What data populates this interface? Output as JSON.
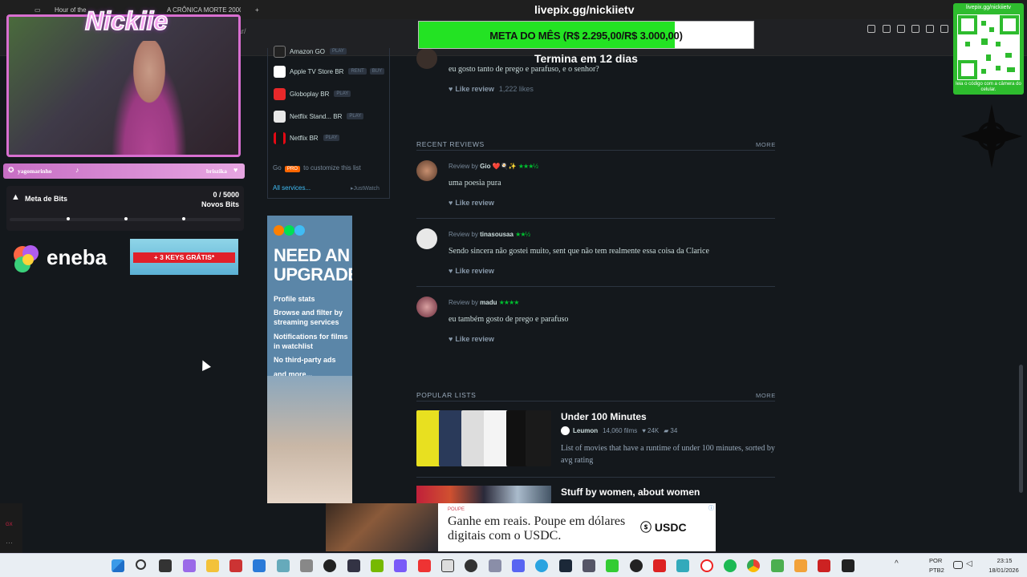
{
  "browser": {
    "tabs": [
      "Hour of the",
      "A CRÔNICA MORTE 2000"
    ],
    "address_fragment": "ar/"
  },
  "services": {
    "items": [
      {
        "name": "Amazon GO",
        "tag": "PLAY",
        "color": "#222"
      },
      {
        "name": "Apple TV Store BR",
        "tag": "RENT",
        "tag2": "BUY",
        "color": "#ffffff"
      },
      {
        "name": "Globoplay BR",
        "tag": "PLAY",
        "color": "#e8282a"
      },
      {
        "name": "Netflix Stand... BR",
        "tag": "PLAY",
        "color": "#e8e8e8"
      },
      {
        "name": "Netflix BR",
        "tag": "PLAY",
        "color": "#e50914"
      }
    ],
    "pro_prefix": "Go",
    "pro_badge": "PRO",
    "pro_suffix": "to customize this list",
    "all_services": "All services...",
    "justwatch": "JustWatch"
  },
  "ad": {
    "title": "NEED AN UPGRADE?",
    "lines": [
      "Profile stats",
      "Browse and filter by streaming services",
      "Notifications for films in watchlist",
      "No third-party ads",
      "and more..."
    ],
    "dot_colors": [
      "#ff8000",
      "#00e054",
      "#40bcf4"
    ]
  },
  "top_review": {
    "text": "eu gosto tanto de prego e parafuso, e o senhor?",
    "like_label": "Like review",
    "likes": "1,222 likes"
  },
  "recent_reviews": {
    "heading": "RECENT REVIEWS",
    "more": "MORE",
    "items": [
      {
        "by_prefix": "Review by",
        "author": "Gio",
        "emoji": "❤️🍳✨",
        "stars": "★★★½",
        "text": "uma poesia pura",
        "like": "Like review"
      },
      {
        "by_prefix": "Review by",
        "author": "tinasousaa",
        "emoji": "",
        "stars": "★★½",
        "text": "Sendo sincera não gostei muito, sent que não tem realmente essa coisa da Clarice",
        "like": "Like review"
      },
      {
        "by_prefix": "Review by",
        "author": "madu",
        "emoji": "",
        "stars": "★★★★",
        "text": "eu também gosto de prego e parafuso",
        "like": "Like review"
      }
    ]
  },
  "popular_lists": {
    "heading": "POPULAR LISTS",
    "more": "MORE",
    "items": [
      {
        "title": "Under 100 Minutes",
        "author": "Leumon",
        "films": "14,060 films",
        "likes": "24K",
        "comments": "34",
        "desc": "List of movies that have a runtime of under 100 minutes, sorted by avg rating"
      },
      {
        "title": "Stuff by women, about women"
      }
    ]
  },
  "overlay": {
    "streamer_logo": "Nickiie",
    "namebar_left": "yagomarinho",
    "namebar_right": "briszika",
    "bits_label": "Meta de Bits",
    "bits_count": "0 / 5000",
    "bits_sub": "Novos Bits",
    "bits_progress": 0.0,
    "eneba": "eneba",
    "keys": "+ 3 KEYS GRÁTIS*",
    "pix_url": "livepix.gg/nickiietv",
    "goal_text": "META DO MÊS (R$ 2.295,00/R$ 3.000,00)",
    "goal_progress": 0.765,
    "ends": "Termina em 12 dias",
    "qr_url": "livepix.gg/nickiietv",
    "qr_caption": "leia o código com a câmera do celular."
  },
  "bottom_ad": {
    "brand": "POUPE",
    "text": "Ganhe em reais. Poupe em dólares digitais com o USDC.",
    "usdc": "USDC"
  },
  "taskbar": {
    "lang1": "POR",
    "lang2": "PTB2",
    "time": "23:15",
    "date": "18/01/2026"
  }
}
